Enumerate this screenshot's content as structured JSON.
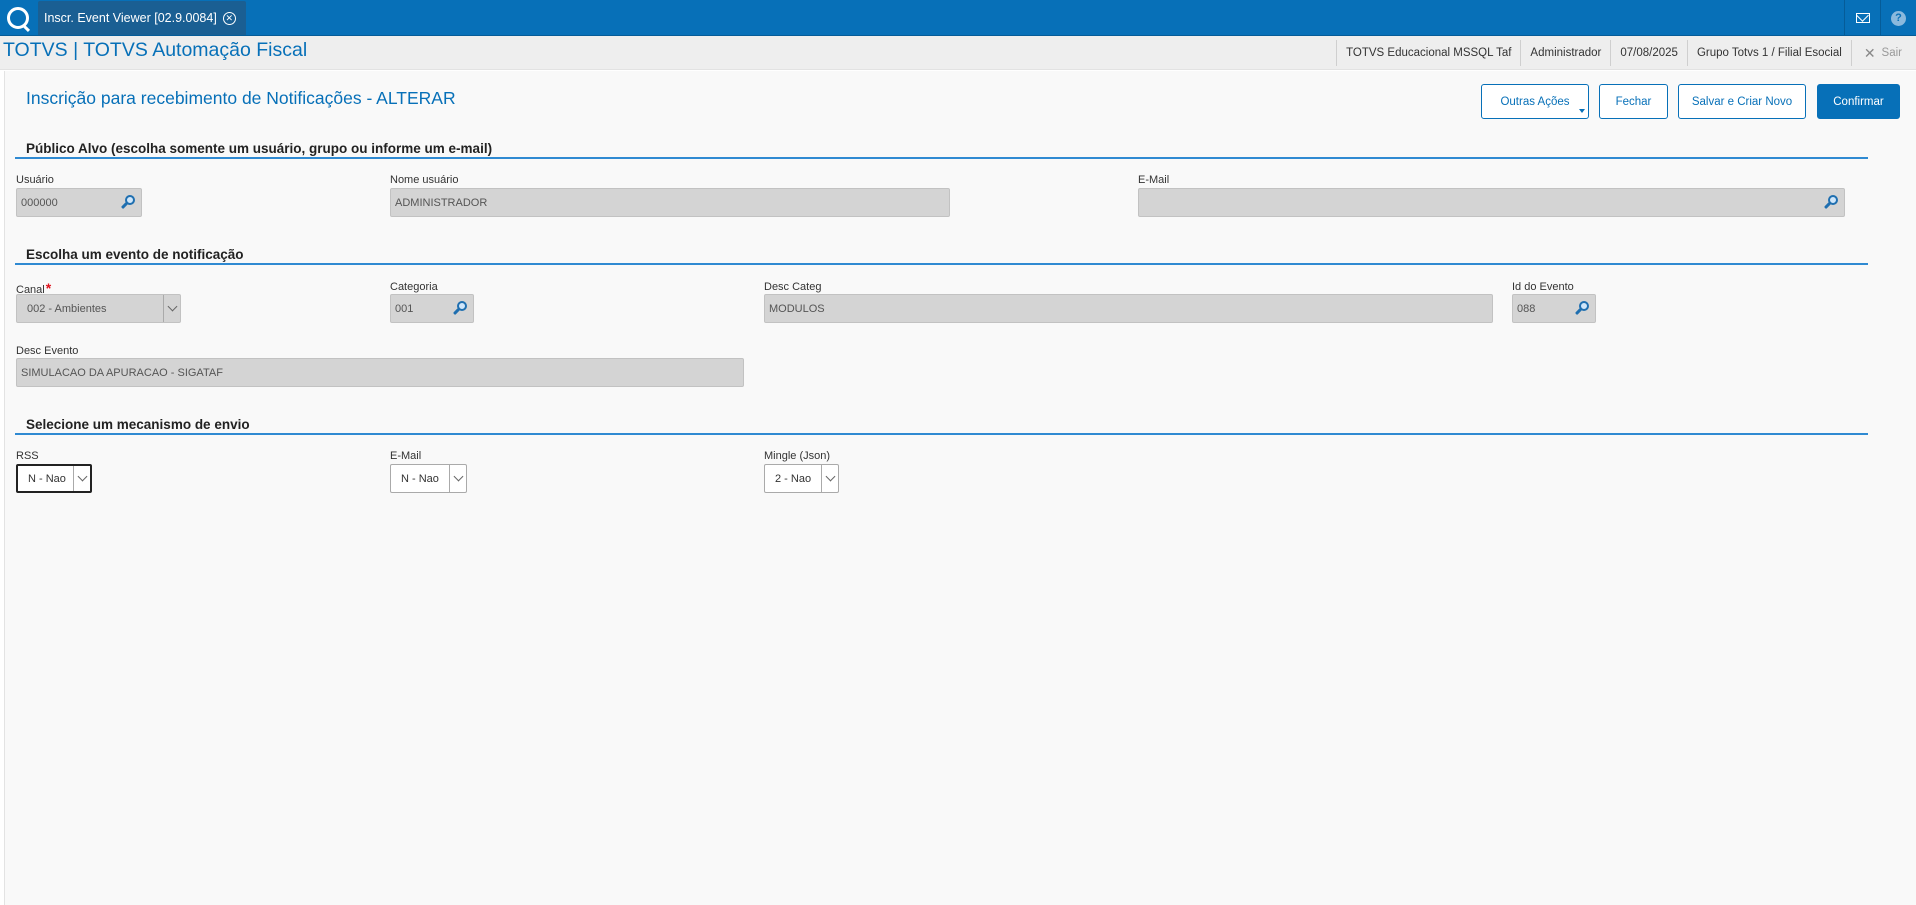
{
  "topbar": {
    "tab_title": "Inscr. Event Viewer [02.9.0084]",
    "logo_icon": "totvs-logo-icon",
    "mail_icon": "mail-icon",
    "help_icon": "help-icon"
  },
  "header": {
    "app_title": "TOTVS | TOTVS Automação Fiscal",
    "environment": "TOTVS Educacional MSSQL Taf",
    "user": "Administrador",
    "date": "07/08/2025",
    "branch": "Grupo Totvs 1 / Filial Esocial",
    "exit_label": "Sair"
  },
  "page": {
    "title": "Inscrição para recebimento de Notificações - ALTERAR",
    "buttons": {
      "other_actions": "Outras Ações",
      "close": "Fechar",
      "save_new": "Salvar e Criar Novo",
      "confirm": "Confirmar"
    }
  },
  "section_audience": {
    "title": "Público Alvo (escolha somente um usuário, grupo ou informe um e-mail)",
    "user_label": "Usuário",
    "user_value": "000000",
    "username_label": "Nome usuário",
    "username_value": "ADMINISTRADOR",
    "email_label": "E-Mail",
    "email_value": ""
  },
  "section_event": {
    "title": "Escolha um evento de notificação",
    "channel_label": "Canal",
    "channel_required": "*",
    "channel_value": "002 - Ambientes",
    "category_label": "Categoria",
    "category_value": "001",
    "desc_categ_label": "Desc Categ",
    "desc_categ_value": "MODULOS",
    "event_id_label": "Id do Evento",
    "event_id_value": "088",
    "desc_event_label": "Desc Evento",
    "desc_event_value": "SIMULACAO DA APURACAO - SIGATAF"
  },
  "section_delivery": {
    "title": "Selecione um mecanismo de envio",
    "rss_label": "RSS",
    "rss_value": "N - Nao",
    "email_label": "E-Mail",
    "email_value": "N - Nao",
    "mingle_label": "Mingle (Json)",
    "mingle_value": "2 - Nao"
  },
  "colors": {
    "brand_blue": "#0770b8",
    "section_line": "#2f8ad2",
    "required": "#e0141e"
  }
}
